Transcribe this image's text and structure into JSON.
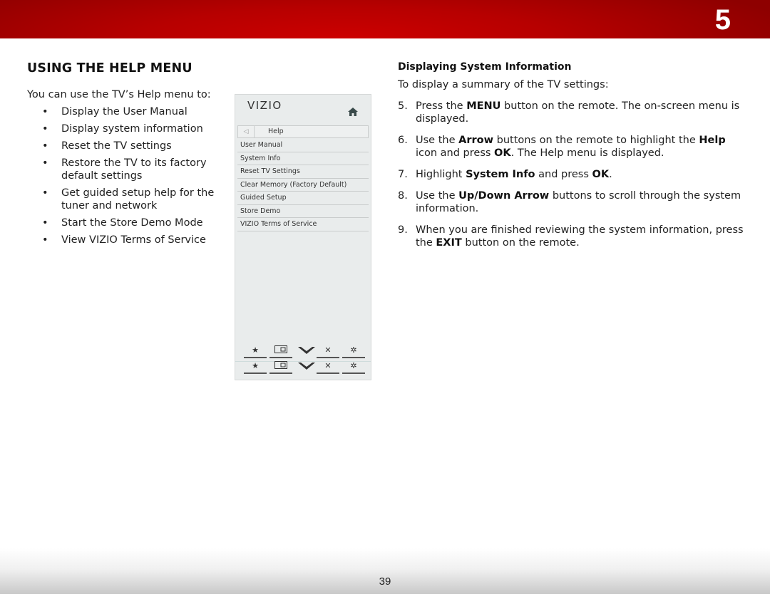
{
  "banner": {
    "chapter_number": "5",
    "color": "#c00000"
  },
  "left": {
    "title": "USING THE HELP MENU",
    "intro": "You can use the TV’s Help menu to:",
    "bullet_char": "•",
    "bullets": [
      "Display the User Manual",
      "Display system information",
      "Reset the TV settings",
      "Restore the TV to its factory default settings",
      "Get guided setup help for the tuner and network",
      "Start the Store Demo Mode",
      "View VIZIO Terms of Service"
    ]
  },
  "tv_menu": {
    "logo": "VIZIO",
    "home_icon": "home-icon",
    "back_icon": "◁",
    "header": "Help",
    "items": [
      "User Manual",
      "System Info",
      "Reset TV Settings",
      "Clear Memory (Factory Default)",
      "Guided Setup",
      "Store Demo",
      "VIZIO Terms of Service"
    ],
    "bottom_icons": [
      {
        "name": "star-icon",
        "glyph": "★"
      },
      {
        "name": "picture-size-icon",
        "glyph": "▭"
      },
      {
        "name": "vizio-v-icon",
        "glyph": "V"
      },
      {
        "name": "close-icon",
        "glyph": "✕"
      },
      {
        "name": "settings-gear-icon",
        "glyph": "✲"
      }
    ]
  },
  "right": {
    "subheading": "Displaying System Information",
    "lead": "To display a summary of the TV settings:",
    "steps": [
      {
        "num": "5.",
        "parts": [
          [
            "Press the ",
            false
          ],
          [
            "MENU",
            true
          ],
          [
            " button on the remote. The on-screen menu is displayed.",
            false
          ]
        ]
      },
      {
        "num": "6.",
        "parts": [
          [
            "Use the ",
            false
          ],
          [
            "Arrow",
            true
          ],
          [
            " buttons on the remote to highlight the ",
            false
          ],
          [
            "Help",
            true
          ],
          [
            " icon and press ",
            false
          ],
          [
            "OK",
            true
          ],
          [
            ". The Help menu is displayed.",
            false
          ]
        ]
      },
      {
        "num": "7.",
        "parts": [
          [
            "Highlight ",
            false
          ],
          [
            "System Info",
            true
          ],
          [
            " and press ",
            false
          ],
          [
            "OK",
            true
          ],
          [
            ".",
            false
          ]
        ]
      },
      {
        "num": "8.",
        "parts": [
          [
            "Use the ",
            false
          ],
          [
            "Up/Down Arrow",
            true
          ],
          [
            " buttons to scroll through the system information.",
            false
          ]
        ]
      },
      {
        "num": "9.",
        "parts": [
          [
            "When you are finished reviewing the system information, press the ",
            false
          ],
          [
            "EXIT",
            true
          ],
          [
            " button on the remote.",
            false
          ]
        ]
      }
    ]
  },
  "footer": {
    "page_number": "39"
  }
}
